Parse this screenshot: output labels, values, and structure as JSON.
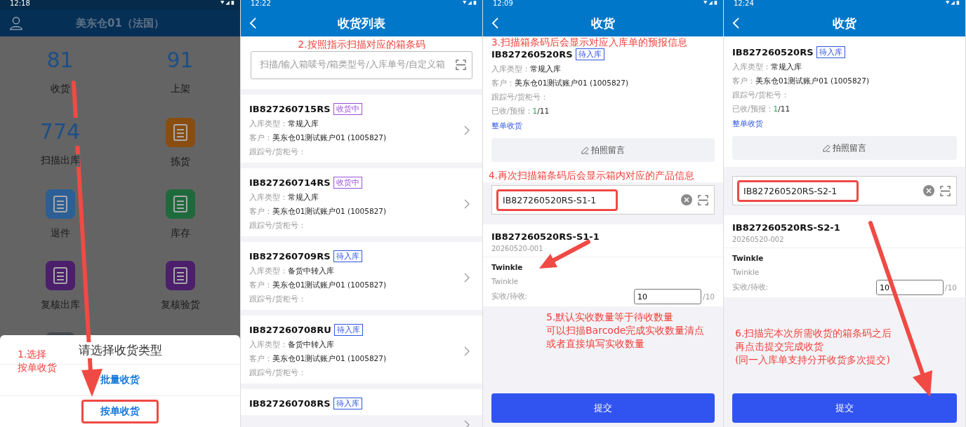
{
  "panels": [
    {
      "kind": "home",
      "status_time": "12:18",
      "title": "美东仓01（法国）",
      "tiles": [
        {
          "kind": "count",
          "value": "81",
          "label": "收货"
        },
        {
          "kind": "count",
          "value": "91",
          "label": "上架"
        },
        {
          "kind": "count",
          "value": "774",
          "label": "扫描出库"
        },
        {
          "kind": "icon",
          "color": "#8a4d10",
          "label": "拣货"
        },
        {
          "kind": "icon",
          "color": "#2c5f95",
          "label": "退件"
        },
        {
          "kind": "icon",
          "color": "#1f6a3c",
          "label": "库存"
        },
        {
          "kind": "icon",
          "color": "#4b1f6b",
          "label": "复核出库"
        },
        {
          "kind": "icon",
          "color": "#4b1f6b",
          "label": "复核验货"
        },
        {
          "kind": "icon",
          "color": "#43474e"
        }
      ],
      "sheet": {
        "title": "请选择收货类型",
        "options": [
          {
            "label": "批量收货",
            "highlighted": false
          },
          {
            "label": "按单收货",
            "highlighted": true
          }
        ]
      },
      "note": [
        "1.选择",
        "按单收货"
      ]
    },
    {
      "kind": "list",
      "status_time": "12:22",
      "title": "收货列表",
      "note": "2.按照指示扫描对应的箱条码",
      "search": {
        "placeholder": "扫描/输入箱唛号/箱类型号/入库单号/自定义箱"
      },
      "orders": [
        {
          "id": "IB827260715RS",
          "status": "收货中",
          "color": "#9b4fd8",
          "type_label": "入库类型：",
          "type": "常规入库",
          "customer_label": "客户：",
          "customer": "美东仓01测试账户01 (1005827)",
          "tracking_label": "跟踪号/货柜号："
        },
        {
          "id": "IB827260714RS",
          "status": "收货中",
          "color": "#9b4fd8",
          "type_label": "入库类型：",
          "type": "常规入库",
          "customer_label": "客户：",
          "customer": "美东仓01测试账户01 (1005827)",
          "tracking_label": "跟踪号/货柜号："
        },
        {
          "id": "IB827260709RS",
          "status": "待入库",
          "color": "#2f55e0",
          "type_label": "入库类型：",
          "type": "备货中转入库",
          "customer_label": "客户：",
          "customer": "美东仓01测试账户01 (1005827)",
          "tracking_label": "跟踪号/货柜号："
        },
        {
          "id": "IB827260708RU",
          "status": "待入库",
          "color": "#2f55e0",
          "type_label": "入库类型：",
          "type": "备货中转入库",
          "customer_label": "客户：",
          "customer": "美东仓01测试账户01 (1005827)",
          "tracking_label": "跟踪号/货柜号："
        },
        {
          "id": "IB827260708RS",
          "status": "待入库",
          "color": "#2f55e0"
        }
      ]
    },
    {
      "kind": "receive",
      "status_time": "12:09",
      "title": "收货",
      "note_top": "3.扫描箱条码后会显示对应入库单的预报信息",
      "order": {
        "id": "IB827260520RS",
        "status": "待入库",
        "color": "#2f55e0",
        "type_label": "入库类型：",
        "type": "常规入库",
        "customer_label": "客户：",
        "customer": "美东仓01测试账户01 (1005827)",
        "tracking_label": "跟踪号/货柜号：",
        "progress_label": "已收/预报：",
        "received": "1",
        "expected": "/11",
        "action": "整单收货",
        "photo_button": "拍照留言"
      },
      "note_scan": "4.再次扫描箱条码后会显示箱内对应的产品信息",
      "scan": {
        "value": "IB827260520RS-S1-1",
        "highlighted": true
      },
      "box": {
        "id": "IB827260520RS-S1-1",
        "batch": "20260520-001",
        "product": "Twinkle",
        "product_sub": "Twinkle",
        "qty_label": "实收/待收:",
        "qty": "10",
        "qty_total": "/10"
      },
      "note_bottom": [
        "5.默认实收数量等于待收数量",
        "可以扫描Barcode完成实收数量清点",
        "或者直接填写实收数量"
      ],
      "submit": "提交"
    },
    {
      "kind": "receive",
      "status_time": "12:24",
      "title": "收货",
      "order": {
        "id": "IB827260520RS",
        "status": "待入库",
        "color": "#2f55e0",
        "type_label": "入库类型：",
        "type": "常规入库",
        "customer_label": "客户：",
        "customer": "美东仓01测试账户01 (1005827)",
        "tracking_label": "跟踪号/货柜号：",
        "progress_label": "已收/预报：",
        "received": "1",
        "expected": "/11",
        "action": "整单收货",
        "photo_button": "拍照留言"
      },
      "scan": {
        "value": "IB827260520RS-S2-1",
        "highlighted": true
      },
      "box": {
        "id": "IB827260520RS-S2-1",
        "batch": "20260520-002",
        "product": "Twinkle",
        "product_sub": "Twinkle",
        "qty_label": "实收/待收:",
        "qty": "10",
        "qty_total": "/10"
      },
      "note_bottom": [
        "6.扫描完本次所需收货的箱条码之后",
        "再点击提交完成收货",
        "(同一入库单支持分开收货多次提交)"
      ],
      "submit": "提交"
    }
  ]
}
